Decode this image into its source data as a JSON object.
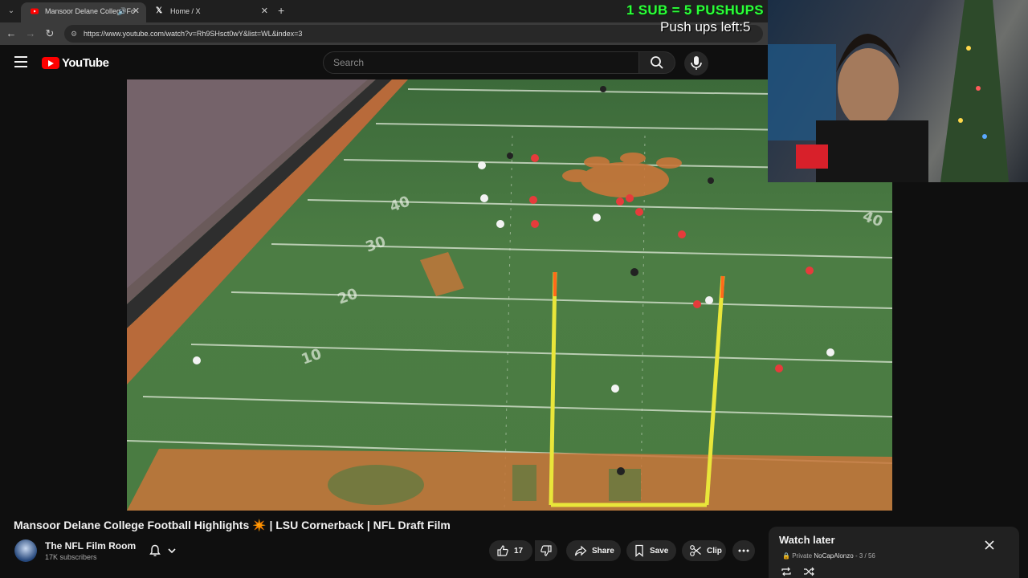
{
  "browser": {
    "tabs": [
      {
        "label": "Mansoor Delane College Fo",
        "active": true
      },
      {
        "label": "Home / X",
        "active": false
      }
    ],
    "url": "https://www.youtube.com/watch?v=Rh9SHsct0wY&list=WL&index=3"
  },
  "youtube": {
    "logo_text": "YouTube",
    "search": {
      "placeholder": "Search",
      "value": ""
    }
  },
  "overlay": {
    "sub_line": "1 SUB = 5 PUSHUPS",
    "pushups_line": "Push ups left:5"
  },
  "video": {
    "title": "Mansoor Delane College Football Highlights ✴️ | LSU Cornerback | NFL Draft Film",
    "channel": "The NFL Film Room",
    "subscribers": "17K subscribers",
    "likes": "17",
    "share_label": "Share",
    "save_label": "Save",
    "clip_label": "Clip"
  },
  "watch_later": {
    "title": "Watch later",
    "privacy": "Private",
    "owner": "NoCapAlonzo",
    "position": "3 / 56"
  },
  "colors": {
    "brand_red": "#ff0000",
    "overlay_green": "#2cff3a",
    "field_green": "#4a7c42",
    "endzone_orange": "#c8763a"
  }
}
